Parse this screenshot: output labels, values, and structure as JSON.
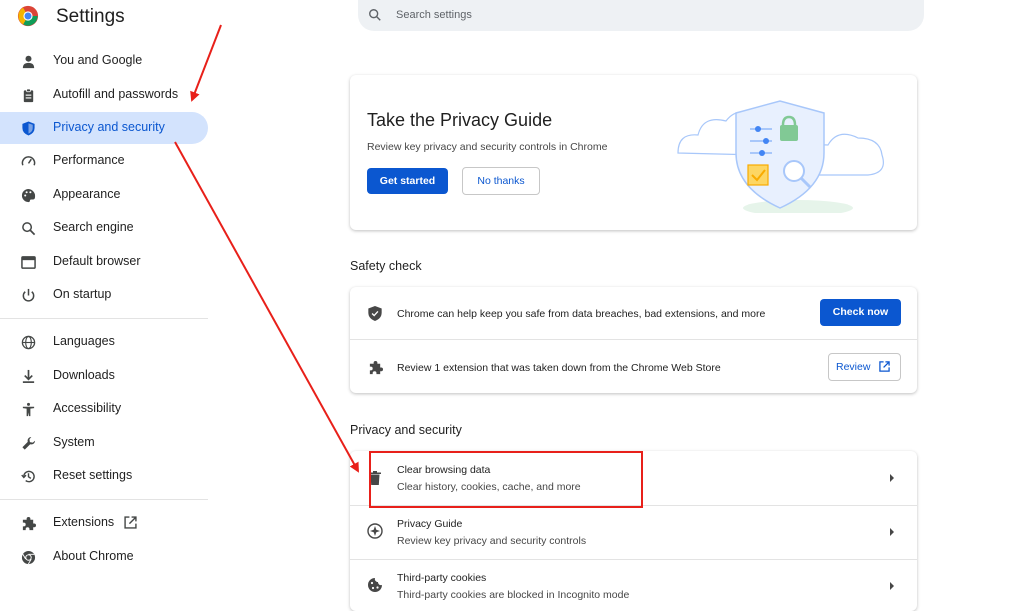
{
  "app": {
    "title": "Settings"
  },
  "search": {
    "placeholder": "Search settings"
  },
  "sidebar": {
    "items": [
      {
        "label": "You and Google",
        "icon": "person-icon"
      },
      {
        "label": "Autofill and passwords",
        "icon": "clipboard-icon"
      },
      {
        "label": "Privacy and security",
        "icon": "shield-icon",
        "active": true
      },
      {
        "label": "Performance",
        "icon": "speedometer-icon"
      },
      {
        "label": "Appearance",
        "icon": "palette-icon"
      },
      {
        "label": "Search engine",
        "icon": "search-icon"
      },
      {
        "label": "Default browser",
        "icon": "browser-window-icon"
      },
      {
        "label": "On startup",
        "icon": "power-icon"
      },
      {
        "label": "Languages",
        "icon": "globe-icon"
      },
      {
        "label": "Downloads",
        "icon": "download-icon"
      },
      {
        "label": "Accessibility",
        "icon": "accessibility-icon"
      },
      {
        "label": "System",
        "icon": "wrench-icon"
      },
      {
        "label": "Reset settings",
        "icon": "history-icon"
      },
      {
        "label": "Extensions",
        "icon": "puzzle-icon"
      },
      {
        "label": "About Chrome",
        "icon": "chrome-icon"
      }
    ]
  },
  "privacy_guide_card": {
    "title": "Take the Privacy Guide",
    "subtitle": "Review key privacy and security controls in Chrome",
    "get_started": "Get started",
    "no_thanks": "No thanks"
  },
  "safety_check": {
    "heading": "Safety check",
    "row1_text": "Chrome can help keep you safe from data breaches, bad extensions, and more",
    "check_now": "Check now",
    "row2_text": "Review 1 extension that was taken down from the Chrome Web Store",
    "review": "Review"
  },
  "privacy_security": {
    "heading": "Privacy and security",
    "rows": [
      {
        "title": "Clear browsing data",
        "subtitle": "Clear history, cookies, cache, and more"
      },
      {
        "title": "Privacy Guide",
        "subtitle": "Review key privacy and security controls"
      },
      {
        "title": "Third-party cookies",
        "subtitle": "Third-party cookies are blocked in Incognito mode"
      }
    ]
  },
  "colors": {
    "accent": "#0b57d0",
    "active_nav_bg": "#d3e3fd",
    "annotation_red": "#e8201a"
  }
}
